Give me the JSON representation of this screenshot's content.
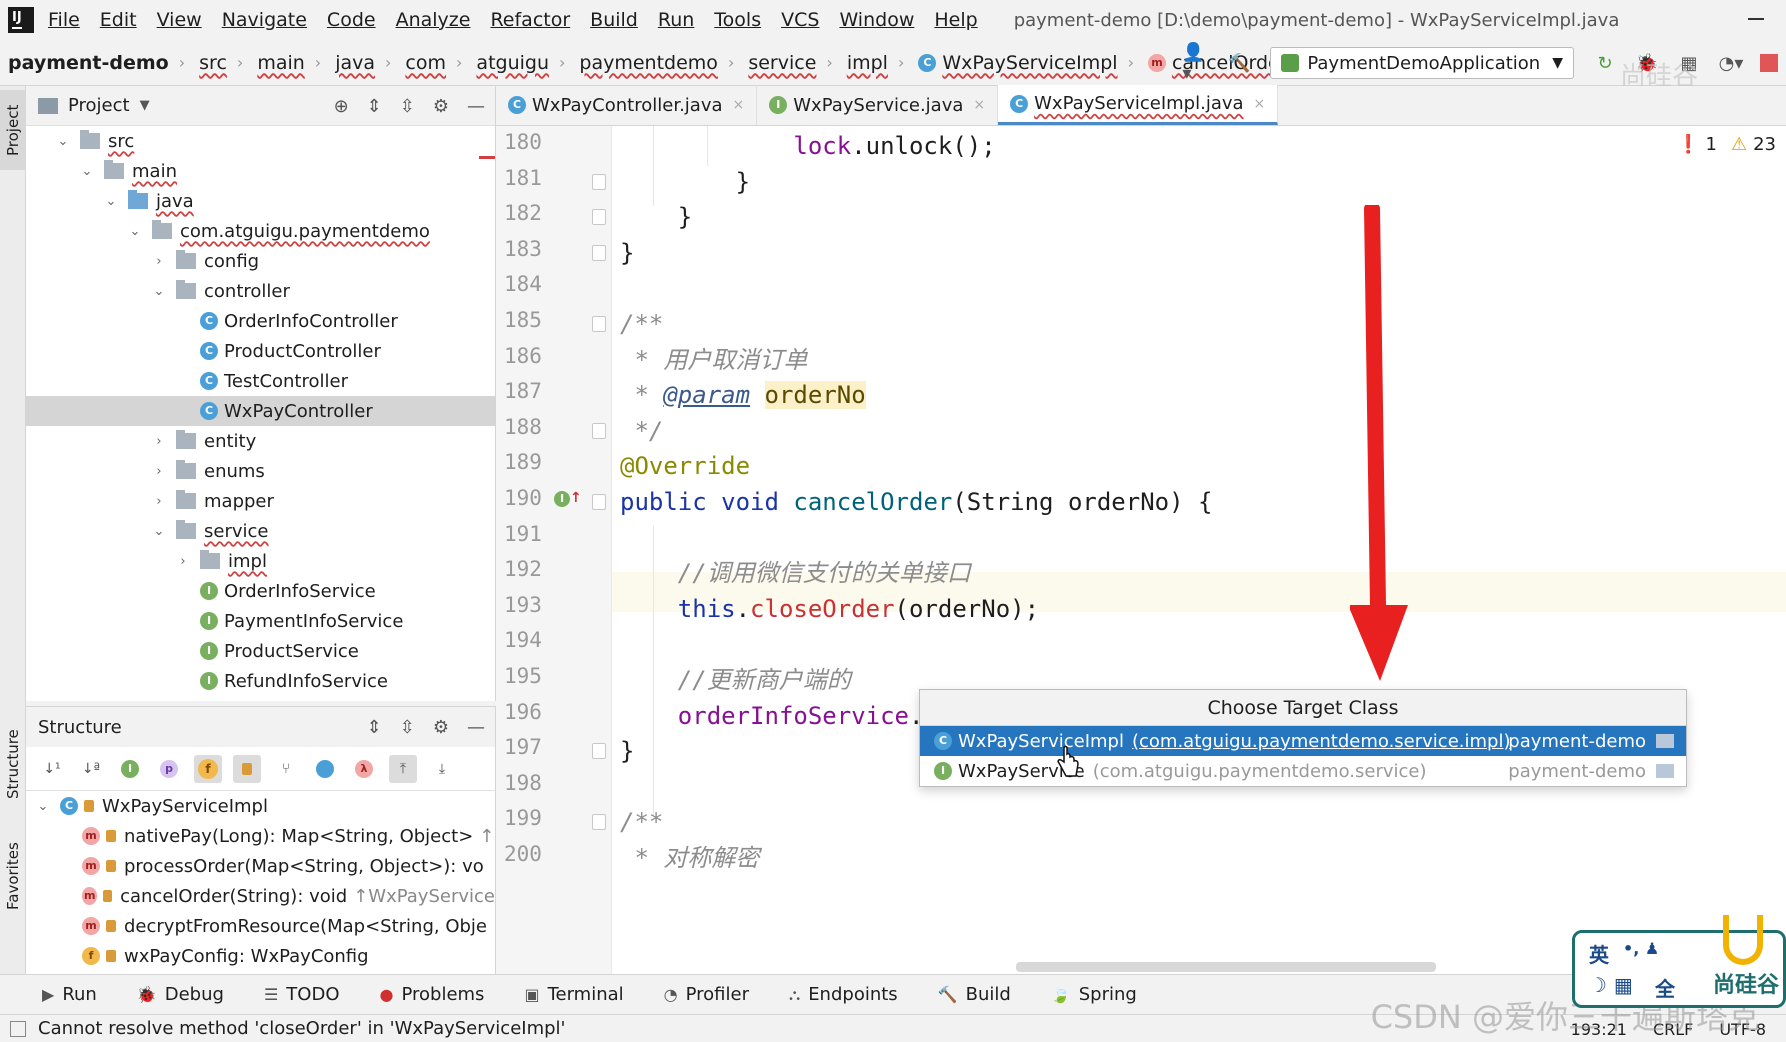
{
  "menubar": {
    "items": [
      "File",
      "Edit",
      "View",
      "Navigate",
      "Code",
      "Analyze",
      "Refactor",
      "Build",
      "Run",
      "Tools",
      "VCS",
      "Window",
      "Help"
    ],
    "window_title": "payment-demo [D:\\demo\\payment-demo] - WxPayServiceImpl.java"
  },
  "navbar": {
    "crumbs": [
      "payment-demo",
      "src",
      "main",
      "java",
      "com",
      "atguigu",
      "paymentdemo",
      "service",
      "impl",
      "WxPayServiceImpl",
      "cancelOrder"
    ],
    "run_config": "PaymentDemoApplication"
  },
  "left_stripe": {
    "project": "Project",
    "structure": "Structure",
    "favorites": "Favorites"
  },
  "project_panel": {
    "title": "Project",
    "tree": [
      {
        "label": "src",
        "indent": 0,
        "arrow": "down",
        "type": "folder"
      },
      {
        "label": "main",
        "indent": 1,
        "arrow": "down",
        "type": "folder"
      },
      {
        "label": "java",
        "indent": 2,
        "arrow": "down",
        "type": "folder-blue"
      },
      {
        "label": "com.atguigu.paymentdemo",
        "indent": 3,
        "arrow": "down",
        "type": "folder"
      },
      {
        "label": "config",
        "indent": 4,
        "arrow": "right",
        "type": "folder"
      },
      {
        "label": "controller",
        "indent": 4,
        "arrow": "down",
        "type": "folder"
      },
      {
        "label": "OrderInfoController",
        "indent": 5,
        "arrow": "",
        "type": "class"
      },
      {
        "label": "ProductController",
        "indent": 5,
        "arrow": "",
        "type": "class"
      },
      {
        "label": "TestController",
        "indent": 5,
        "arrow": "",
        "type": "class"
      },
      {
        "label": "WxPayController",
        "indent": 5,
        "arrow": "",
        "type": "class",
        "selected": true
      },
      {
        "label": "entity",
        "indent": 4,
        "arrow": "right",
        "type": "folder"
      },
      {
        "label": "enums",
        "indent": 4,
        "arrow": "right",
        "type": "folder"
      },
      {
        "label": "mapper",
        "indent": 4,
        "arrow": "right",
        "type": "folder"
      },
      {
        "label": "service",
        "indent": 4,
        "arrow": "down",
        "type": "folder"
      },
      {
        "label": "impl",
        "indent": 5,
        "arrow": "right",
        "type": "folder"
      },
      {
        "label": "OrderInfoService",
        "indent": 5,
        "arrow": "",
        "type": "interface"
      },
      {
        "label": "PaymentInfoService",
        "indent": 5,
        "arrow": "",
        "type": "interface"
      },
      {
        "label": "ProductService",
        "indent": 5,
        "arrow": "",
        "type": "interface"
      },
      {
        "label": "RefundInfoService",
        "indent": 5,
        "arrow": "",
        "type": "interface"
      }
    ]
  },
  "structure_panel": {
    "title": "Structure",
    "root": "WxPayServiceImpl",
    "members": [
      {
        "kind": "m",
        "label": "nativePay(Long): Map<String, Object>",
        "suffix": "↑"
      },
      {
        "kind": "m",
        "label": "processOrder(Map<String, Object>): vo",
        "suffix": ""
      },
      {
        "kind": "m",
        "label": "cancelOrder(String): void",
        "suffix": "↑WxPayService"
      },
      {
        "kind": "m",
        "label": "decryptFromResource(Map<String, Obje",
        "suffix": ""
      },
      {
        "kind": "f",
        "label": "wxPayConfig: WxPayConfig",
        "suffix": ""
      }
    ]
  },
  "tabs": [
    {
      "label": "WxPayController.java",
      "icon": "C",
      "active": false
    },
    {
      "label": "WxPayService.java",
      "icon": "I",
      "active": false
    },
    {
      "label": "WxPayServiceImpl.java",
      "icon": "C",
      "active": true
    }
  ],
  "inspections": {
    "errors": "1",
    "warnings": "23"
  },
  "editor": {
    "lines": [
      {
        "num": "180",
        "html": "            <span class=\"field\">lock</span>.unlock();"
      },
      {
        "num": "181",
        "html": "        }"
      },
      {
        "num": "182",
        "html": "    }"
      },
      {
        "num": "183",
        "html": "}"
      },
      {
        "num": "184",
        "html": ""
      },
      {
        "num": "185",
        "html": "<span class=\"cmt\">/**</span>"
      },
      {
        "num": "186",
        "html": "<span class=\"cmt\"> * 用户取消订单</span>"
      },
      {
        "num": "187",
        "html": "<span class=\"cmt\"> * </span><span class=\"tag\">@param</span> <span class=\"param\">orderNo</span>"
      },
      {
        "num": "188",
        "html": "<span class=\"cmt\"> */</span>"
      },
      {
        "num": "189",
        "html": "<span class=\"ann\">@Override</span>"
      },
      {
        "num": "190",
        "html": "<span class=\"kw\">public void</span> <span class=\"fn\">cancelOrder</span>(String orderNo) {"
      },
      {
        "num": "191",
        "html": ""
      },
      {
        "num": "192",
        "html": "    <span class=\"cmt\">//调用微信支付的关单接口</span>"
      },
      {
        "num": "193",
        "html": "    <span class=\"kw\">this</span>.<span class=\"err\">closeOrder</span>(orderNo);"
      },
      {
        "num": "194",
        "html": ""
      },
      {
        "num": "195",
        "html": "    <span class=\"cmt\">//更新商户端的</span>"
      },
      {
        "num": "196",
        "html": "    <span class=\"field\">orderInfoService</span>.updateStatusByOrderNo(orderNo, OrderStatus.<span class=\"field\">CANCEL</span>);"
      },
      {
        "num": "197",
        "html": "}"
      },
      {
        "num": "198",
        "html": ""
      },
      {
        "num": "199",
        "html": "<span class=\"cmt\">/**</span>"
      },
      {
        "num": "200",
        "html": "<span class=\"cmt\"> * 对称解密</span>"
      }
    ]
  },
  "popup": {
    "title": "Choose Target Class",
    "options": [
      {
        "name": "WxPayServiceImpl",
        "pkg": "(com.atguigu.paymentdemo.service.impl)",
        "module": "payment-demo",
        "icon": "C",
        "selected": true
      },
      {
        "name": "WxPayService",
        "pkg": "(com.atguigu.paymentdemo.service)",
        "module": "payment-demo",
        "icon": "I",
        "selected": false
      }
    ]
  },
  "bottom_bar": [
    "Run",
    "Debug",
    "TODO",
    "Problems",
    "Terminal",
    "Profiler",
    "Endpoints",
    "Build",
    "Spring"
  ],
  "status": {
    "message": "Cannot resolve method 'closeOrder' in 'WxPayServiceImpl'",
    "position": "193:21",
    "line_sep": "CRLF",
    "encoding": "UTF-8"
  },
  "overlay": {
    "csdn": "CSDN @爱你三千遍斯塔克",
    "brand_top": "尚硅谷",
    "brand_widget": "尚硅谷",
    "ime_en": "英",
    "ime_full": "全"
  },
  "colors": {
    "accent": "#2675bf",
    "error": "#c83232",
    "annotation_arrow": "#e82020"
  }
}
